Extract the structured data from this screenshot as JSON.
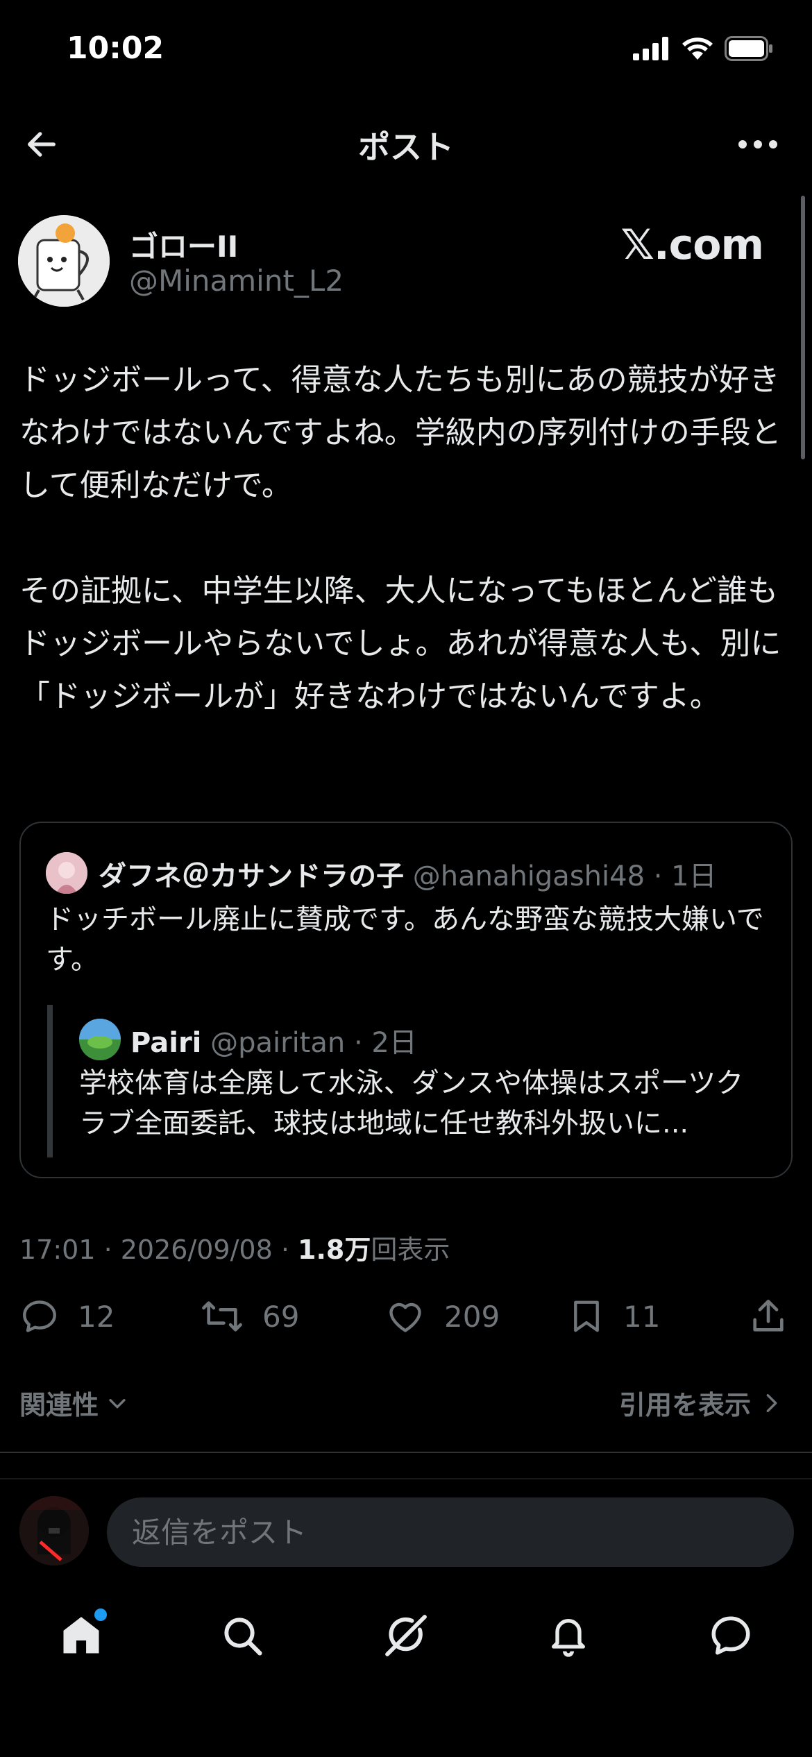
{
  "status_bar": {
    "time": "10:02"
  },
  "header": {
    "title": "ポスト"
  },
  "post": {
    "author_name": "ゴローII",
    "author_handle": "@Minamint_L2",
    "badge_text": "𝕏.com",
    "paragraphs": [
      "ドッジボールって、得意な人たちも別にあの競技が好きなわけではないんですよね。学級内の序列付けの手段として便利なだけで。",
      "その証拠に、中学生以降、大人になってもほとんど誰もドッジボールやらないでしょ。あれが得意な人も、別に「ドッジボールが」好きなわけではないんですよ。"
    ],
    "quote": {
      "name": "ダフネ＠カサンドラの子",
      "handle": "@hanahigashi48",
      "time": "· 1日",
      "text": "ドッチボール廃止に賛成です。あんな野蛮な競技大嫌いです。",
      "inner": {
        "name": "Pairi",
        "handle": "@pairitan",
        "time": "· 2日",
        "text": "学校体育は全廃して水泳、ダンスや体操はスポーツクラブ全面委託、球技は地域に任せ教科外扱いに..."
      }
    },
    "meta": {
      "timestamp": "17:01 · 2026/09/08 · ",
      "views": "1.8万",
      "views_label": "回表示"
    },
    "actions": {
      "replies": "12",
      "reposts": "69",
      "likes": "209",
      "bookmarks": "11"
    }
  },
  "sort": {
    "label": "関連性",
    "quotes_link": "引用を表示"
  },
  "reply": {
    "placeholder": "返信をポスト"
  },
  "tabbar": {
    "items": [
      "home-icon",
      "search-icon",
      "grok-icon",
      "notifications-icon",
      "messages-icon"
    ]
  },
  "colors": {
    "background": "#000000",
    "text": "#e7e9ea",
    "muted": "#71767b",
    "accent": "#1d9bf0",
    "border": "#2f3336"
  }
}
